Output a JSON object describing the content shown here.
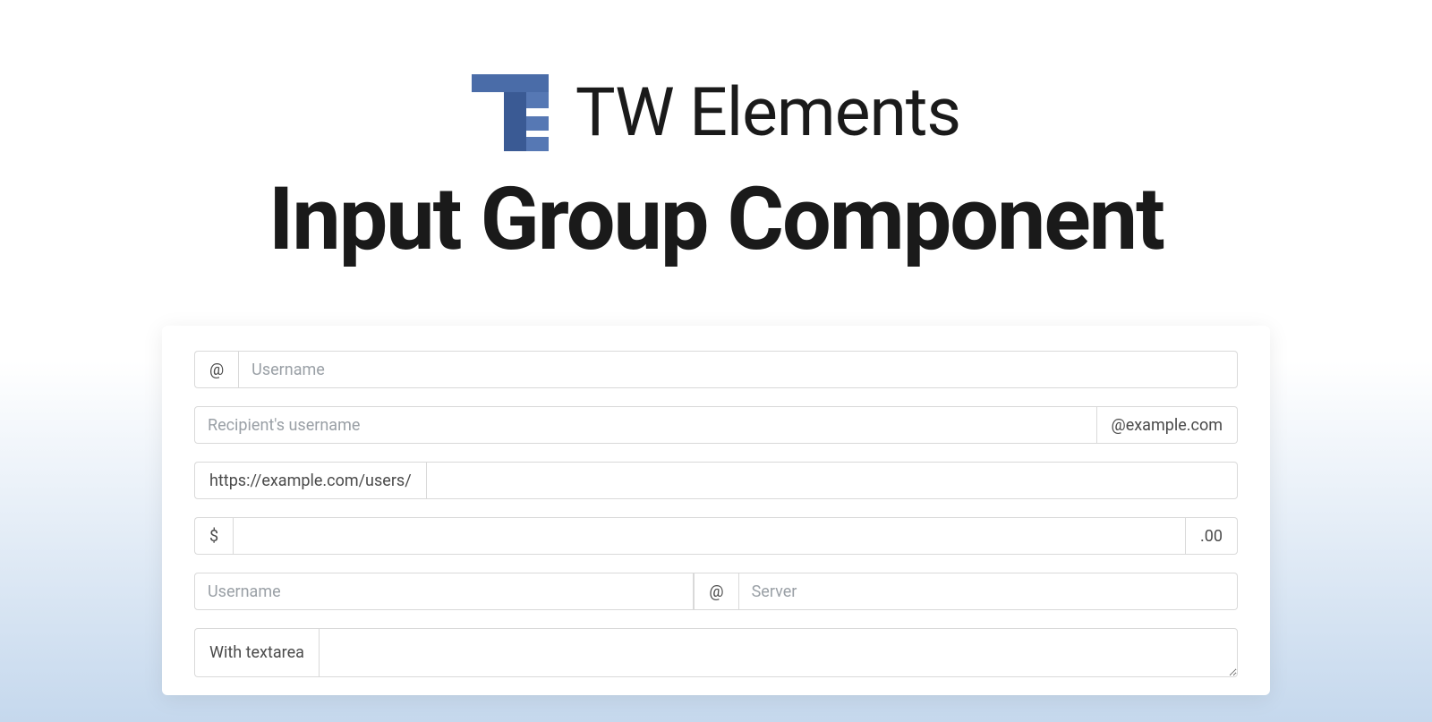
{
  "brand": {
    "name": "TW Elements"
  },
  "subtitle": "Input Group Component",
  "inputs": {
    "row1": {
      "prefix": "@",
      "placeholder": "Username"
    },
    "row2": {
      "placeholder": "Recipient's username",
      "suffix": "@example.com"
    },
    "row3": {
      "prefix": "https://example.com/users/"
    },
    "row4": {
      "prefix": "$",
      "suffix": ".00"
    },
    "row5": {
      "placeholder_left": "Username",
      "separator": "@",
      "placeholder_right": "Server"
    },
    "row6": {
      "label": "With textarea"
    }
  }
}
